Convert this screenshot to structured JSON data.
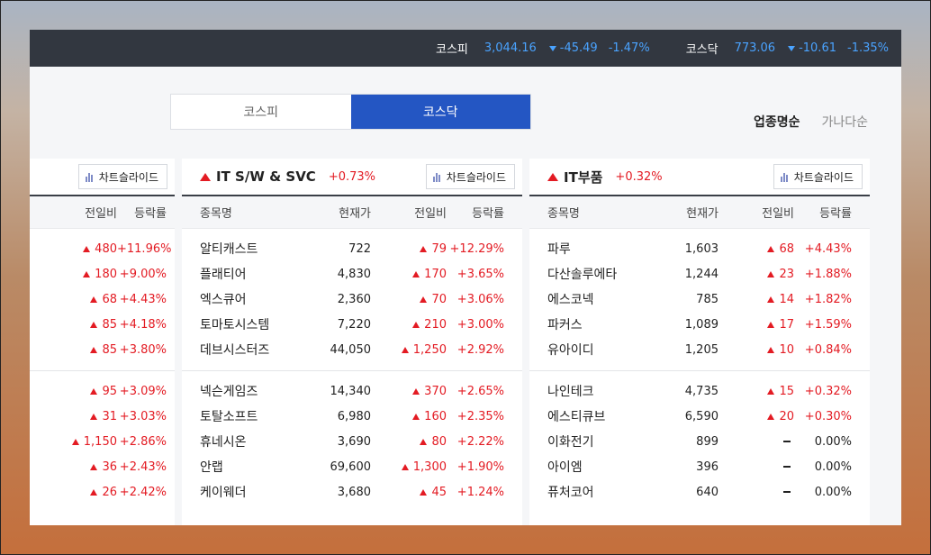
{
  "topbar": {
    "indices": [
      {
        "name": "코스피",
        "value": "3,044.16",
        "change": "-45.49",
        "rate": "-1.47%"
      },
      {
        "name": "코스닥",
        "value": "773.06",
        "change": "-10.61",
        "rate": "-1.35%"
      }
    ]
  },
  "tabs": [
    {
      "label": "코스피",
      "active": false
    },
    {
      "label": "코스닥",
      "active": true
    }
  ],
  "sort": {
    "option1": "업종명순",
    "option2": "가나다순"
  },
  "chart_slide_label": "차트슬라이드",
  "columns": {
    "name": "종목명",
    "price": "현재가",
    "change": "전일비",
    "rate": "등락률"
  },
  "panels": [
    {
      "sector": "",
      "sector_rate": "",
      "rows": [
        {
          "change": "480",
          "rate": "+11.96%",
          "dir": "up"
        },
        {
          "change": "180",
          "rate": "+9.00%",
          "dir": "up"
        },
        {
          "change": "68",
          "rate": "+4.43%",
          "dir": "up"
        },
        {
          "change": "85",
          "rate": "+4.18%",
          "dir": "up"
        },
        {
          "change": "85",
          "rate": "+3.80%",
          "dir": "up"
        },
        {
          "change": "95",
          "rate": "+3.09%",
          "dir": "up"
        },
        {
          "change": "31",
          "rate": "+3.03%",
          "dir": "up"
        },
        {
          "change": "1,150",
          "rate": "+2.86%",
          "dir": "up"
        },
        {
          "change": "36",
          "rate": "+2.43%",
          "dir": "up"
        },
        {
          "change": "26",
          "rate": "+2.42%",
          "dir": "up"
        }
      ]
    },
    {
      "sector": "IT S/W & SVC",
      "sector_rate": "+0.73%",
      "rows": [
        {
          "name": "알티캐스트",
          "price": "722",
          "change": "79",
          "rate": "+12.29%",
          "dir": "up"
        },
        {
          "name": "플래티어",
          "price": "4,830",
          "change": "170",
          "rate": "+3.65%",
          "dir": "up"
        },
        {
          "name": "엑스큐어",
          "price": "2,360",
          "change": "70",
          "rate": "+3.06%",
          "dir": "up"
        },
        {
          "name": "토마토시스템",
          "price": "7,220",
          "change": "210",
          "rate": "+3.00%",
          "dir": "up"
        },
        {
          "name": "데브시스터즈",
          "price": "44,050",
          "change": "1,250",
          "rate": "+2.92%",
          "dir": "up"
        },
        {
          "name": "넥슨게임즈",
          "price": "14,340",
          "change": "370",
          "rate": "+2.65%",
          "dir": "up"
        },
        {
          "name": "토탈소프트",
          "price": "6,980",
          "change": "160",
          "rate": "+2.35%",
          "dir": "up"
        },
        {
          "name": "휴네시온",
          "price": "3,690",
          "change": "80",
          "rate": "+2.22%",
          "dir": "up"
        },
        {
          "name": "안랩",
          "price": "69,600",
          "change": "1,300",
          "rate": "+1.90%",
          "dir": "up"
        },
        {
          "name": "케이웨더",
          "price": "3,680",
          "change": "45",
          "rate": "+1.24%",
          "dir": "up"
        }
      ]
    },
    {
      "sector": "IT부품",
      "sector_rate": "+0.32%",
      "rows": [
        {
          "name": "파루",
          "price": "1,603",
          "change": "68",
          "rate": "+4.43%",
          "dir": "up"
        },
        {
          "name": "다산솔루에타",
          "price": "1,244",
          "change": "23",
          "rate": "+1.88%",
          "dir": "up"
        },
        {
          "name": "에스코넥",
          "price": "785",
          "change": "14",
          "rate": "+1.82%",
          "dir": "up"
        },
        {
          "name": "파커스",
          "price": "1,089",
          "change": "17",
          "rate": "+1.59%",
          "dir": "up"
        },
        {
          "name": "유아이디",
          "price": "1,205",
          "change": "10",
          "rate": "+0.84%",
          "dir": "up"
        },
        {
          "name": "나인테크",
          "price": "4,735",
          "change": "15",
          "rate": "+0.32%",
          "dir": "up"
        },
        {
          "name": "에스티큐브",
          "price": "6,590",
          "change": "20",
          "rate": "+0.30%",
          "dir": "up"
        },
        {
          "name": "이화전기",
          "price": "899",
          "change": "",
          "rate": "0.00%",
          "dir": "flat"
        },
        {
          "name": "아이엠",
          "price": "396",
          "change": "",
          "rate": "0.00%",
          "dir": "flat"
        },
        {
          "name": "퓨처코어",
          "price": "640",
          "change": "",
          "rate": "0.00%",
          "dir": "flat"
        }
      ]
    }
  ]
}
